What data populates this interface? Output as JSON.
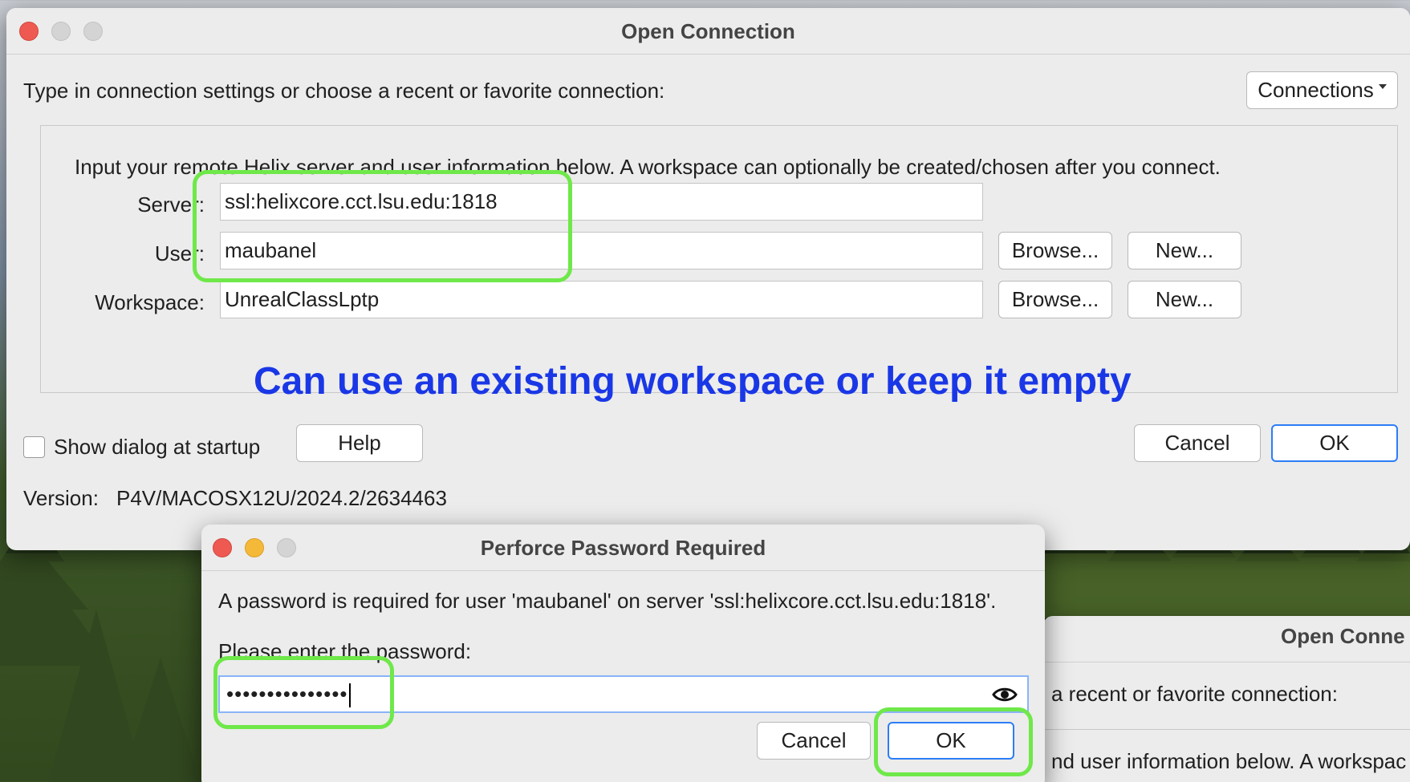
{
  "main_window": {
    "title": "Open Connection",
    "intro": "Type in connection settings or choose a recent or favorite connection:",
    "connections_button": "Connections",
    "group_description": "Input your remote Helix server and user information below. A workspace can optionally be created/chosen after you connect.",
    "fields": {
      "server_label": "Server:",
      "server_value": "ssl:helixcore.cct.lsu.edu:1818",
      "user_label": "User:",
      "user_value": "maubanel",
      "workspace_label": "Workspace:",
      "workspace_value": "UnrealClassLptp"
    },
    "browse_label": "Browse...",
    "new_label": "New...",
    "annotation": "Can use an existing workspace or keep it empty",
    "show_dialog_label": "Show dialog at startup",
    "help_label": "Help",
    "cancel_label": "Cancel",
    "ok_label": "OK",
    "version_label": "Version:",
    "version_value": "P4V/MACOSX12U/2024.2/2634463"
  },
  "back_window": {
    "title": "Open Conne",
    "text1": "a recent or favorite connection:",
    "text2": "nd user information below. A workspac"
  },
  "password_dialog": {
    "title": "Perforce Password Required",
    "message": "A password is required for user 'maubanel' on server 'ssl:helixcore.cct.lsu.edu:1818'.",
    "prompt": "Please enter the password:",
    "password_mask": "•••••••••••••••",
    "cancel_label": "Cancel",
    "ok_label": "OK"
  },
  "colors": {
    "annotation": "#1a37e6",
    "highlight": "#6fe84a",
    "accent": "#2d7df6"
  }
}
